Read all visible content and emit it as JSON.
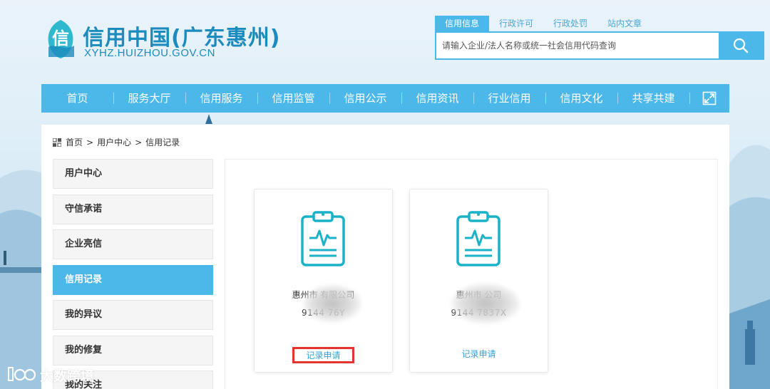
{
  "header": {
    "logo_title": "信用中国(广东惠州)",
    "logo_subtitle": "XYHZ.HUIZHOU.GOV.CN",
    "logo_glyph": "信"
  },
  "search": {
    "tabs": [
      {
        "label": "信用信息",
        "active": true
      },
      {
        "label": "行政许可",
        "active": false
      },
      {
        "label": "行政处罚",
        "active": false
      },
      {
        "label": "站内文章",
        "active": false
      }
    ],
    "placeholder": "请输入企业/法人名称或统一社会信用代码查询",
    "button_icon": "search-icon"
  },
  "nav": {
    "items": [
      "首页",
      "服务大厅",
      "信用服务",
      "信用监管",
      "信用公示",
      "信用资讯",
      "行业信用",
      "信用文化",
      "共享共建"
    ],
    "expand_icon": "fullscreen-icon"
  },
  "breadcrumb": {
    "icon": "grid-icon",
    "items": [
      "首页",
      "用户中心",
      "信用记录"
    ],
    "separator": ">"
  },
  "sidebar": {
    "items": [
      {
        "label": "用户中心",
        "active": false
      },
      {
        "label": "守信承诺",
        "active": false
      },
      {
        "label": "企业亮信",
        "active": false
      },
      {
        "label": "信用记录",
        "active": true
      },
      {
        "label": "我的异议",
        "active": false
      },
      {
        "label": "我的修复",
        "active": false
      },
      {
        "label": "我的关注",
        "active": false
      }
    ]
  },
  "cards": [
    {
      "name": "惠州市        有限公司",
      "code": "9144            76Y",
      "action": "记录申请",
      "highlighted": true
    },
    {
      "name": "惠州市              公司",
      "code": "9144            7837X",
      "action": "记录申请",
      "highlighted": false
    }
  ],
  "watermark": {
    "text": "大数跨境",
    "mark_icon": "watermark-logo-icon"
  },
  "colors": {
    "primary": "#4cb8ea",
    "logo": "#1c8bbd",
    "link": "#2ea3db",
    "highlight": "#e3342f",
    "icon_teal": "#1ab2c9"
  }
}
